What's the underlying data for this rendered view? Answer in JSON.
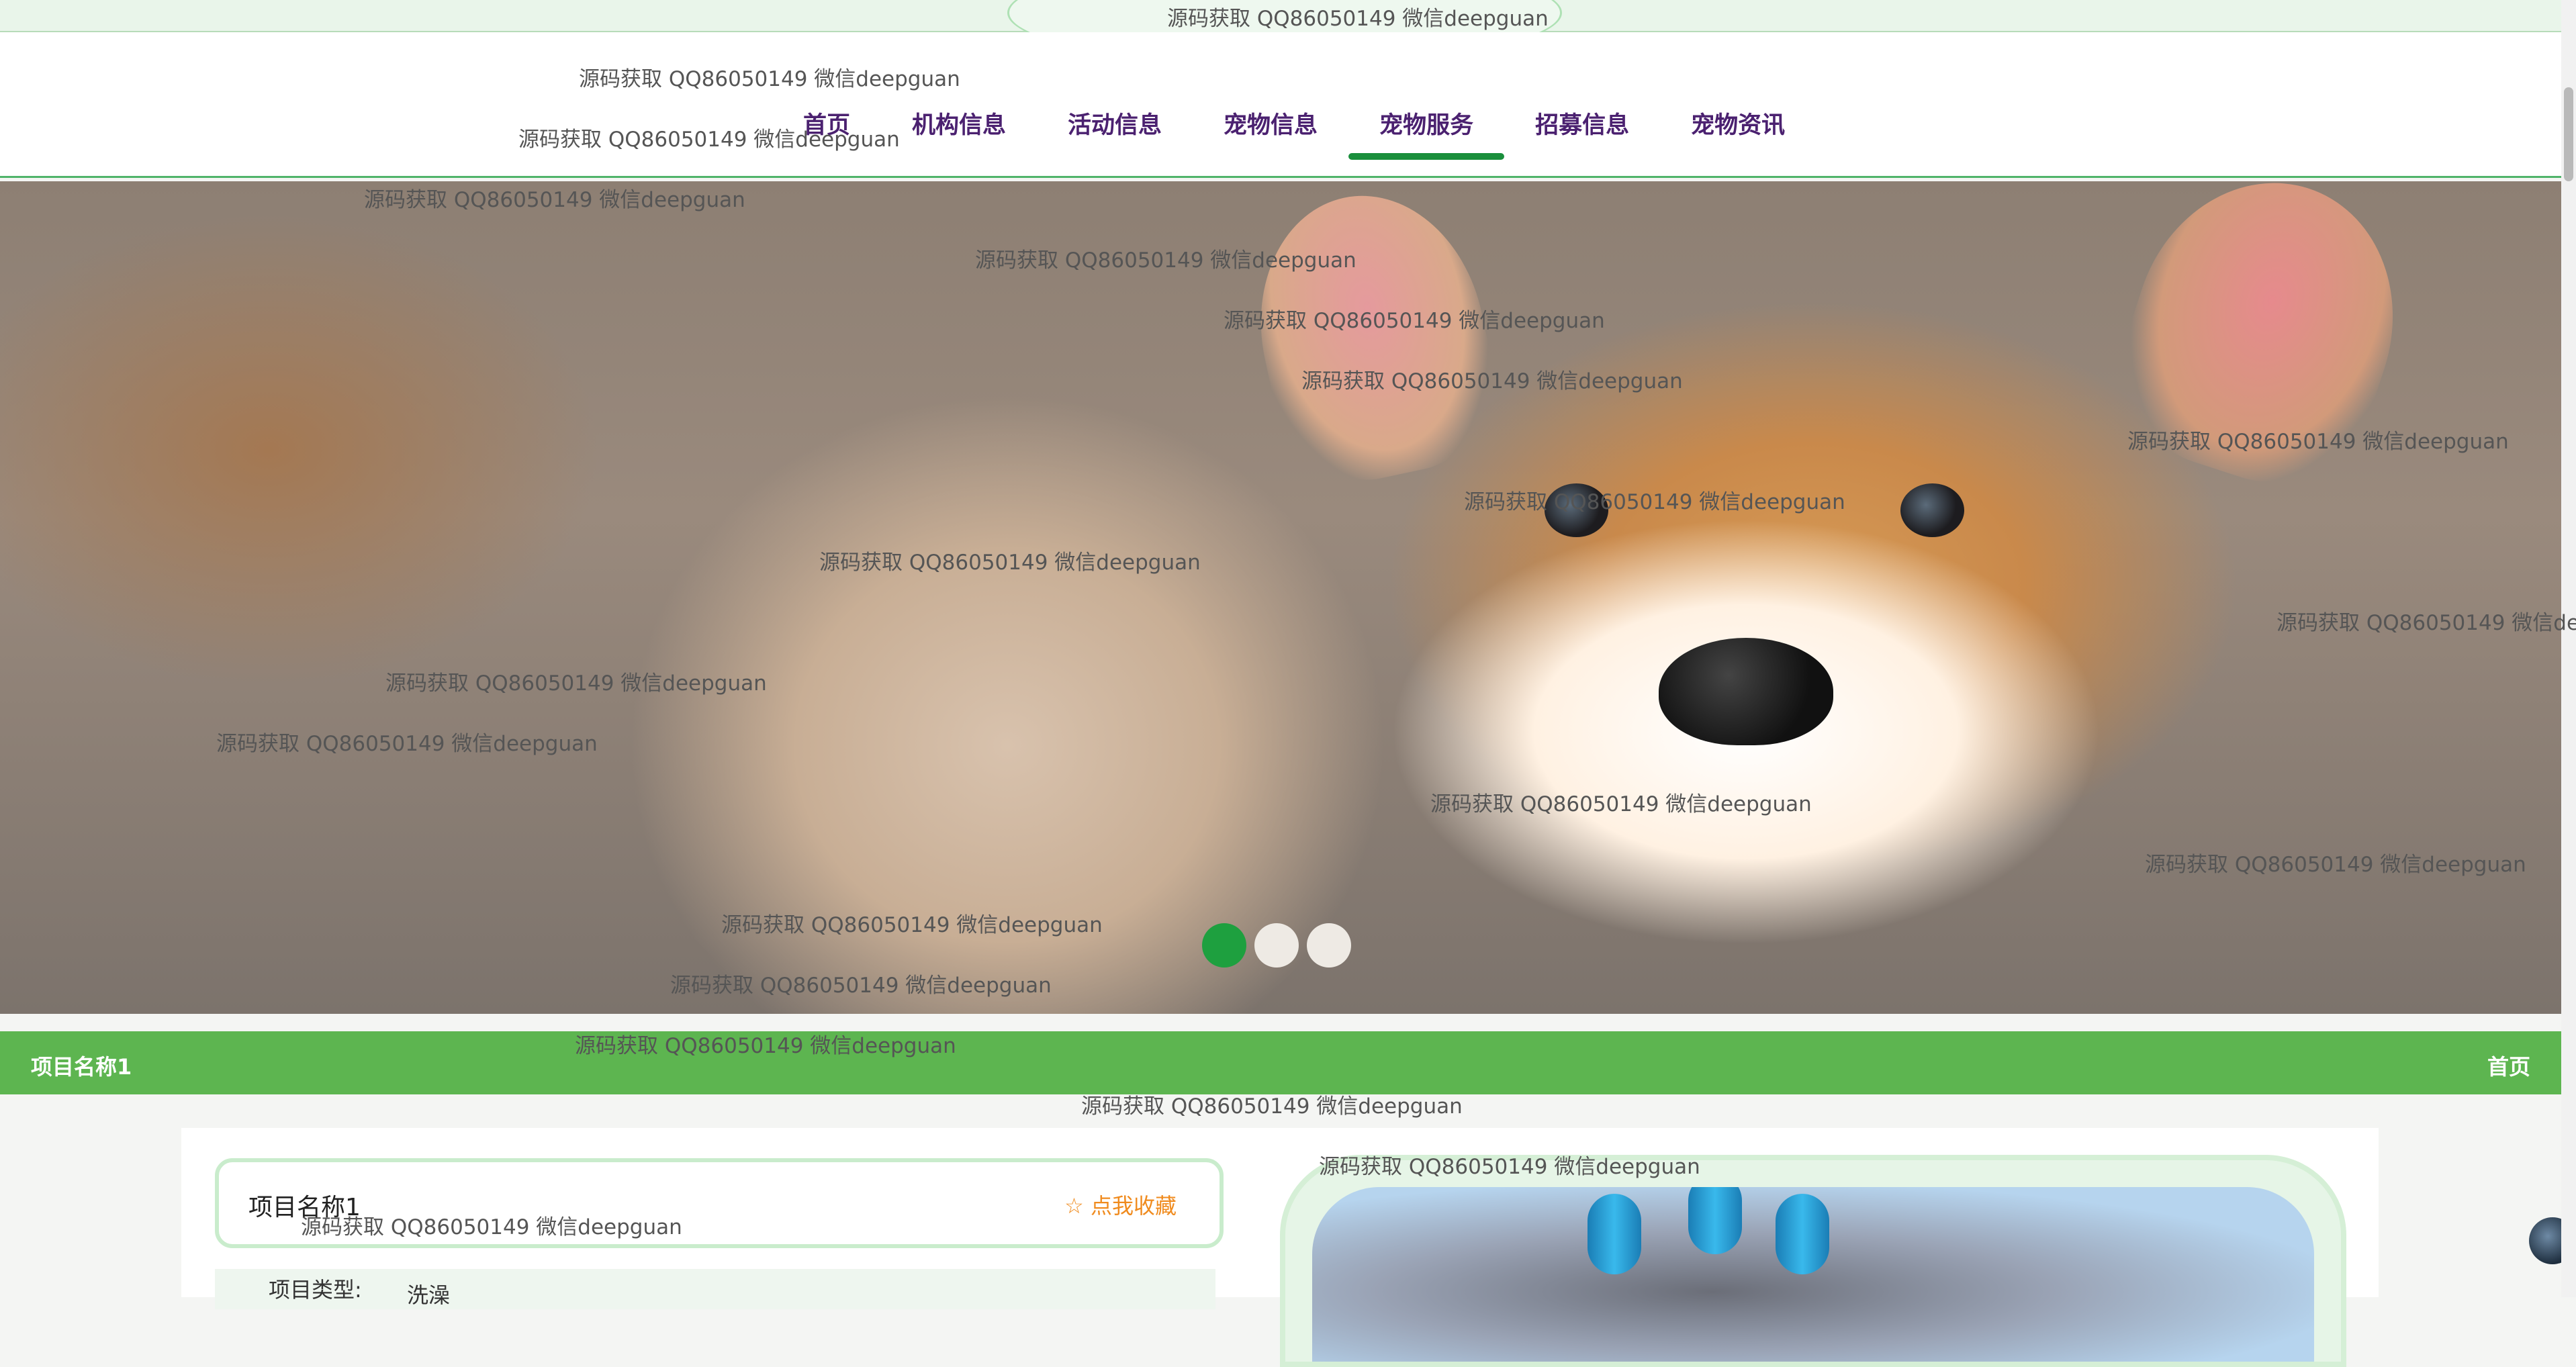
{
  "nav": {
    "items": [
      {
        "label": "首页",
        "active": false
      },
      {
        "label": "机构信息",
        "active": false
      },
      {
        "label": "活动信息",
        "active": false
      },
      {
        "label": "宠物信息",
        "active": false
      },
      {
        "label": "宠物服务",
        "active": true
      },
      {
        "label": "招募信息",
        "active": false
      },
      {
        "label": "宠物资讯",
        "active": false
      }
    ]
  },
  "banner": {
    "slide_count": 3,
    "active_slide": 1
  },
  "breadcrumb": {
    "current": "项目名称1",
    "home": "首页"
  },
  "detail": {
    "title": "项目名称1",
    "favorite_label": "☆ 点我收藏",
    "type_label": "项目类型:",
    "type_value": "洗澡"
  },
  "watermark": {
    "text": "源码获取 QQ86050149 微信deepguan"
  },
  "colors": {
    "nav_text": "#4b2170",
    "accent_green": "#5db550",
    "active_underline": "#1a8f3c",
    "favorite": "#f08b1e"
  }
}
